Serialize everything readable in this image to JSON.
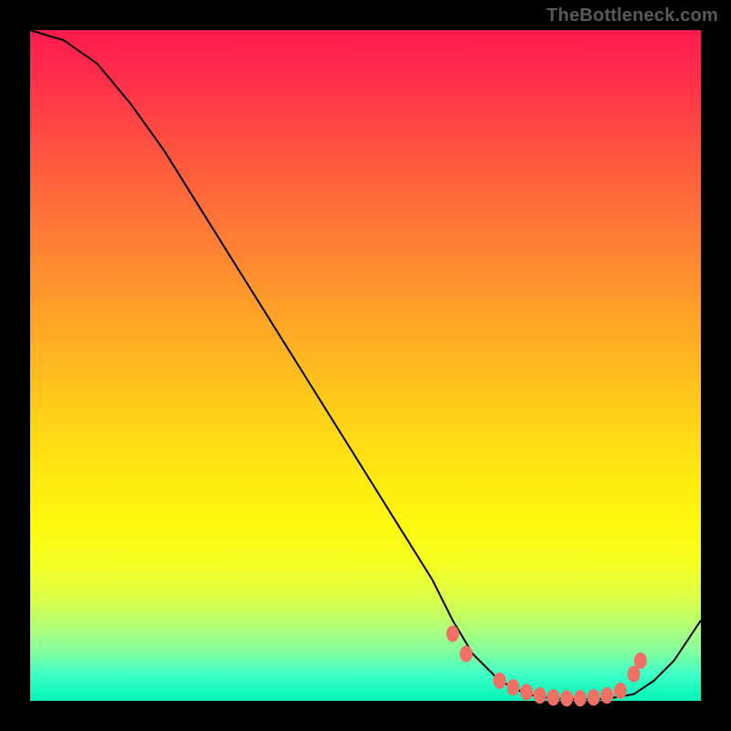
{
  "watermark": "TheBottleneck.com",
  "chart_data": {
    "type": "line",
    "title": "",
    "xlabel": "",
    "ylabel": "",
    "xlim": [
      0,
      100
    ],
    "ylim": [
      0,
      100
    ],
    "grid": false,
    "legend": false,
    "series": [
      {
        "name": "curve",
        "x": [
          0,
          5,
          10,
          15,
          20,
          25,
          30,
          35,
          40,
          45,
          50,
          55,
          60,
          63,
          66,
          70,
          74,
          78,
          82,
          86,
          90,
          93,
          96,
          100
        ],
        "y": [
          100,
          98.5,
          95,
          89,
          82,
          74,
          66,
          58,
          50,
          42,
          34,
          26,
          18,
          12,
          7,
          3,
          1,
          0.3,
          0.2,
          0.3,
          1,
          3,
          6,
          12
        ]
      }
    ],
    "markers": {
      "name": "highlight",
      "shape": "circle",
      "color": "#f07066",
      "points": [
        {
          "x": 63,
          "y": 10
        },
        {
          "x": 65,
          "y": 7
        },
        {
          "x": 70,
          "y": 3
        },
        {
          "x": 72,
          "y": 2
        },
        {
          "x": 74,
          "y": 1.3
        },
        {
          "x": 76,
          "y": 0.8
        },
        {
          "x": 78,
          "y": 0.5
        },
        {
          "x": 80,
          "y": 0.4
        },
        {
          "x": 82,
          "y": 0.4
        },
        {
          "x": 84,
          "y": 0.5
        },
        {
          "x": 86,
          "y": 0.8
        },
        {
          "x": 88,
          "y": 1.5
        },
        {
          "x": 90,
          "y": 4
        },
        {
          "x": 91,
          "y": 6
        }
      ]
    },
    "background_gradient": {
      "top": "#ff1a4d",
      "mid": "#ffe812",
      "bottom": "#00f5b8"
    }
  }
}
